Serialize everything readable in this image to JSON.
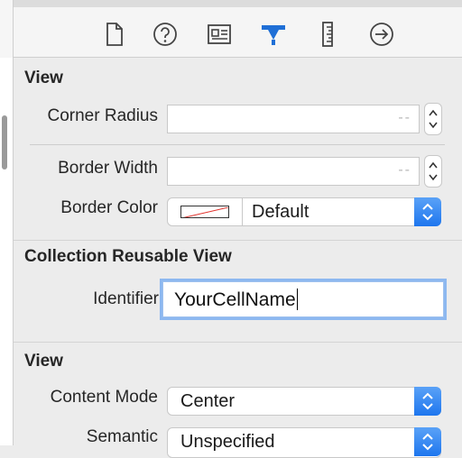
{
  "toolbar": {
    "tabs": [
      {
        "name": "file-inspector",
        "icon": "document-icon"
      },
      {
        "name": "quick-help",
        "icon": "help-icon"
      },
      {
        "name": "identity-inspector",
        "icon": "identity-card-icon"
      },
      {
        "name": "attributes-inspector",
        "icon": "attributes-icon",
        "selected": true
      },
      {
        "name": "size-inspector",
        "icon": "ruler-icon"
      },
      {
        "name": "connections-inspector",
        "icon": "arrow-circle-icon"
      }
    ],
    "selected_color": "#1f6fd6"
  },
  "view_section": {
    "title": "View",
    "corner_radius": {
      "label": "Corner Radius",
      "placeholder": "--",
      "value": ""
    },
    "border_width": {
      "label": "Border Width",
      "placeholder": "--",
      "value": ""
    },
    "border_color": {
      "label": "Border Color",
      "value": "Default"
    }
  },
  "reusable_section": {
    "title": "Collection Reusable View",
    "identifier": {
      "label": "Identifier",
      "value": "YourCellName"
    }
  },
  "view_section_2": {
    "title": "View",
    "content_mode": {
      "label": "Content Mode",
      "value": "Center"
    },
    "semantic": {
      "label": "Semantic",
      "value": "Unspecified"
    }
  },
  "colors": {
    "accent": "#2a7cf0",
    "focus_ring": "#8db8f0"
  }
}
